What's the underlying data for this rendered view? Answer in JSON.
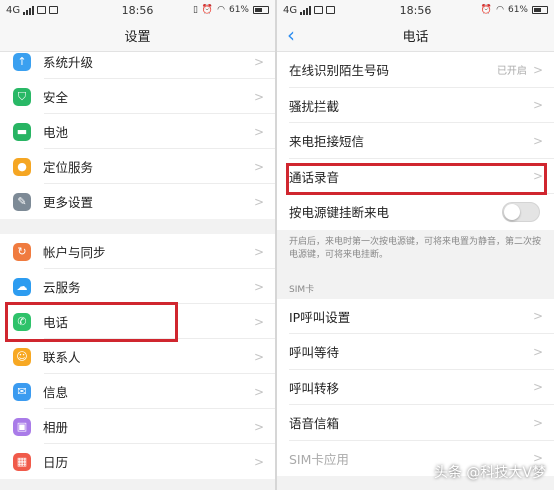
{
  "status_left": {
    "network": "4G",
    "time": "18:56",
    "battery": "61%",
    "battery_level": 0.61
  },
  "status_right": {
    "network": "4G",
    "time": "18:56",
    "battery": "61%",
    "battery_level": 0.61
  },
  "settings": {
    "title": "设置",
    "items_top": [
      {
        "label": "系统升级",
        "icon": "system-update-icon",
        "color": "#3aa0f0"
      },
      {
        "label": "安全",
        "icon": "shield-icon",
        "color": "#29b866"
      },
      {
        "label": "电池",
        "icon": "battery-icon",
        "color": "#28b463"
      },
      {
        "label": "定位服务",
        "icon": "location-icon",
        "color": "#f5a623"
      },
      {
        "label": "更多设置",
        "icon": "wrench-icon",
        "color": "#7d8a96"
      }
    ],
    "items_bottom": [
      {
        "label": "帐户与同步",
        "icon": "account-icon",
        "color": "#f07b3f"
      },
      {
        "label": "云服务",
        "icon": "cloud-icon",
        "color": "#2d9cf0"
      },
      {
        "label": "电话",
        "icon": "phone-icon",
        "color": "#2ec26a"
      },
      {
        "label": "联系人",
        "icon": "contacts-icon",
        "color": "#f7a823"
      },
      {
        "label": "信息",
        "icon": "message-icon",
        "color": "#3b9bf0"
      },
      {
        "label": "相册",
        "icon": "gallery-icon",
        "color": "#a97be8"
      },
      {
        "label": "日历",
        "icon": "calendar-icon",
        "color": "#f05a4a"
      }
    ]
  },
  "phone": {
    "title": "电话",
    "items_top": [
      {
        "label": "在线识别陌生号码",
        "value": "已开启"
      },
      {
        "label": "骚扰拦截"
      },
      {
        "label": "来电拒接短信"
      },
      {
        "label": "通话录音"
      }
    ],
    "power_hangup": {
      "label": "按电源键挂断来电",
      "enabled": false
    },
    "hint": "开启后，来电时第一次按电源键，可将来电置为静音，第二次按电源键，可将来电挂断。",
    "section_label": "SIM卡",
    "sim_items": [
      {
        "label": "IP呼叫设置"
      },
      {
        "label": "呼叫等待"
      },
      {
        "label": "呼叫转移"
      },
      {
        "label": "语音信箱"
      },
      {
        "label": "SIM卡应用"
      }
    ]
  },
  "watermark": "头条 @科技大V梦",
  "highlight_color": "#d0262f"
}
